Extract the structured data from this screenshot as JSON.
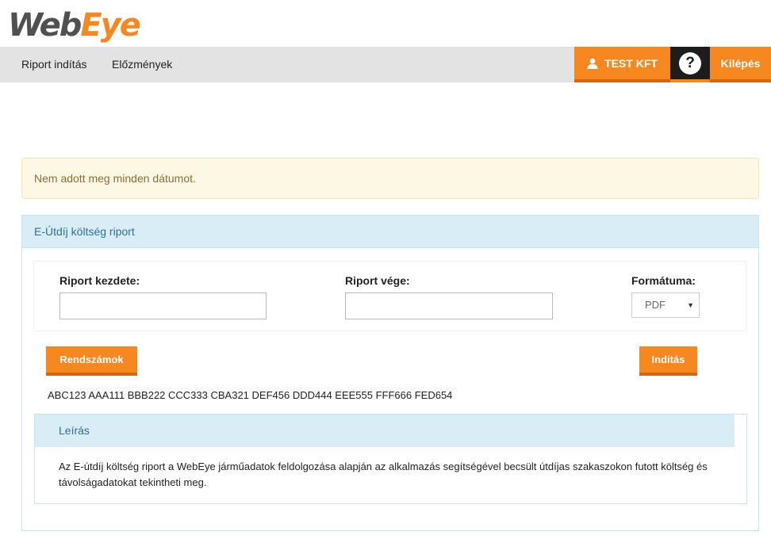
{
  "brand": {
    "logo_part1": "Web",
    "logo_part2": "Eye"
  },
  "nav": {
    "items": [
      "Riport indítás",
      "Előzmények"
    ],
    "user_label": "TEST KFT",
    "help_label": "?",
    "logout_label": "Kilépés"
  },
  "alert": {
    "text": "Nem adott meg minden dátumot."
  },
  "panel": {
    "title": "E-Útdíj költség riport",
    "form": {
      "start_label": "Riport kezdete:",
      "start_value": "",
      "end_label": "Riport vége:",
      "end_value": "",
      "format_label": "Formátuma:",
      "format_selected": "PDF"
    },
    "plates_button": "Rendszámok",
    "start_button": "Indítás",
    "plates_text": "ABC123 AAA111 BBB222 CCC333 CBA321 DEF456 DDD444 EEE555 FFF666 FED654",
    "description": {
      "title": "Leírás",
      "text": "Az E-útdíj költség riport a WebEye járműadatok feldolgozása alapján az alkalmazás segítségével becsült útdíjas szakaszokon futott költség és távolságadatokat tekintheti meg."
    }
  },
  "colors": {
    "accent": "#f7871f",
    "accent_dark": "#d9640c",
    "info_bg": "#d9edf7",
    "info_text": "#31708f",
    "warning_bg": "#fcf8e3",
    "warning_text": "#8a6d3b"
  },
  "icons": {
    "user": "user-icon",
    "help": "help-icon",
    "select_arrow": "caret-down-icon"
  }
}
